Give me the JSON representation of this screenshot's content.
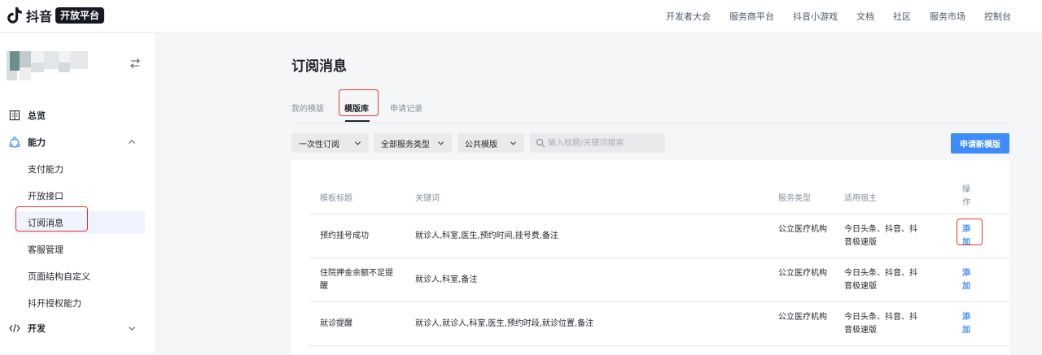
{
  "brand": {
    "name": "抖音",
    "badge": "开放平台"
  },
  "topnav": [
    "开发者大会",
    "服务商平台",
    "抖音小游戏",
    "文档",
    "社区",
    "服务市场",
    "控制台"
  ],
  "sidebar": {
    "overview": "总览",
    "capability": "能力",
    "capability_items": [
      "支付能力",
      "开放接口",
      "订阅消息",
      "客服管理",
      "页面结构自定义",
      "抖开授权能力"
    ],
    "develop": "开发",
    "active_item": "订阅消息"
  },
  "page": {
    "title": "订阅消息"
  },
  "tabs": [
    "我的模版",
    "模版库",
    "申请记录"
  ],
  "active_tab": "模版库",
  "filters": {
    "select1": "一次性订阅",
    "select2": "全部服务类型",
    "select3": "公共模版",
    "search_placeholder": "输入标题/关键词搜索",
    "apply_button": "申请新模版"
  },
  "table": {
    "headers": [
      "模板标题",
      "关键词",
      "服务类型",
      "适用宿主",
      "操作"
    ],
    "rows": [
      {
        "title": "预约挂号成功",
        "keywords": "就诊人,科室,医生,预约时间,挂号费,备注",
        "service": "公立医疗机构",
        "hosts": "今日头条、抖音、抖音极速版",
        "action": "添加"
      },
      {
        "title": "住院押金余额不足提醒",
        "keywords": "就诊人,科室,备注",
        "service": "公立医疗机构",
        "hosts": "今日头条、抖音、抖音极速版",
        "action": "添加"
      },
      {
        "title": "就诊提醒",
        "keywords": "就诊人,就诊人,科室,医生,预约时段,就诊位置,备注",
        "service": "公立医疗机构",
        "hosts": "今日头条、抖音、抖音极速版",
        "action": "添加"
      }
    ]
  },
  "colors": {
    "accent": "#3e8cf7",
    "highlight": "#e13b32",
    "active_bg": "#eef3fd"
  }
}
